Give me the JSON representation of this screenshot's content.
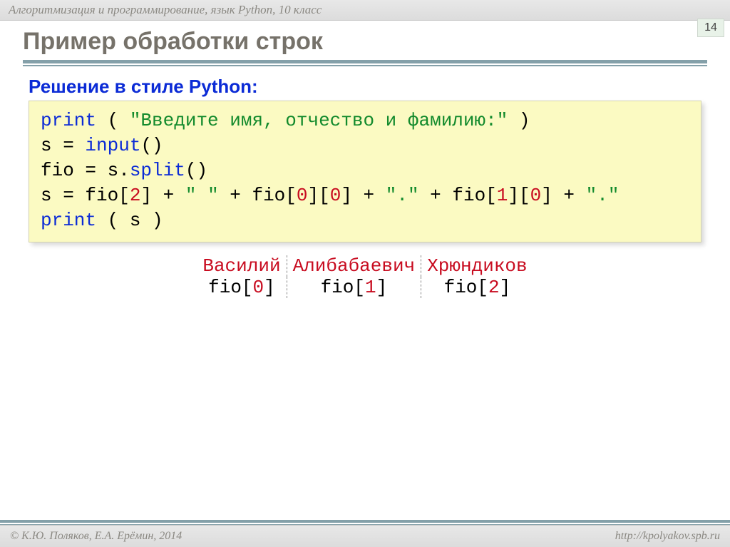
{
  "header": {
    "course": "Алгоритмизация и программирование, язык Python, 10 класс",
    "slide_number": "14"
  },
  "title": "Пример обработки строк",
  "subtitle": "Решение в стиле Python:",
  "code": {
    "l1_print": "print",
    "l1_open": " ( ",
    "l1_str": "\"Введите имя, отчество и фамилию:\"",
    "l1_close": " )",
    "l2_a": "s = ",
    "l2_input": "input",
    "l2_b": "()",
    "l3_a": "fio = s.",
    "l3_split": "split",
    "l3_b": "()",
    "l4_a": "s = fio[",
    "l4_2": "2",
    "l4_b": "] + ",
    "l4_sp": "\" \"",
    "l4_c": " + fio[",
    "l4_0a": "0",
    "l4_d": "][",
    "l4_0b": "0",
    "l4_e": "] + ",
    "l4_dot1": "\".\"",
    "l4_f": " + fio[",
    "l4_1a": "1",
    "l4_g": "][",
    "l4_0c": "0",
    "l4_h": "] + ",
    "l4_dot2": "\".\"",
    "l5_print": "print",
    "l5_rest": " ( s )"
  },
  "example": {
    "names": [
      "Василий",
      "Алибабаевич",
      "Хрюндиков"
    ],
    "indices_pre": "fio[",
    "indices": [
      "0",
      "1",
      "2"
    ],
    "indices_post": "]"
  },
  "footer": {
    "left": "© К.Ю. Поляков, Е.А. Ерёмин, 2014",
    "right": "http://kpolyakov.spb.ru"
  }
}
